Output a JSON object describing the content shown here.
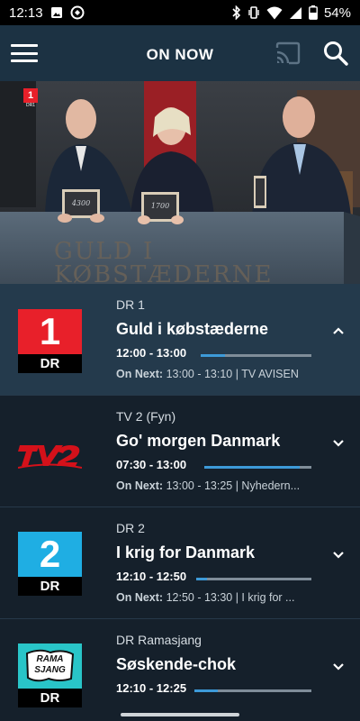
{
  "status_bar": {
    "time": "12:13",
    "battery": "54%"
  },
  "app_bar": {
    "title": "ON NOW"
  },
  "video": {
    "channel_badge": "1",
    "channel_badge_sub": "DR1",
    "set_text": "GULD I KØBSTÆDERNE",
    "slate_left": "4300",
    "slate_right": "1700"
  },
  "rows": [
    {
      "channel": "DR 1",
      "title": "Guld i købstæderne",
      "time": "12:00 - 13:00",
      "on_next_label": "On Next:",
      "on_next": " 13:00 - 13:10 | TV AVISEN",
      "progress": 0.22,
      "logo_digit": "1",
      "logo_text": "DR",
      "logo_color": "#e8202a",
      "expanded": true
    },
    {
      "channel": "TV 2 (Fyn)",
      "title": "Go' morgen Danmark",
      "time": "07:30 - 13:00",
      "on_next_label": "On Next:",
      "on_next": " 13:00 - 13:25 | Nyhedern...",
      "progress": 0.89,
      "logo_text": "TV2",
      "logo_color": "#d4111a",
      "expanded": false
    },
    {
      "channel": "DR 2",
      "title": "I krig for Danmark",
      "time": "12:10 - 12:50",
      "on_next_label": "On Next:",
      "on_next": " 12:50 - 13:30 | I krig for ...",
      "progress": 0.09,
      "logo_digit": "2",
      "logo_text": "DR",
      "logo_color": "#1faee3",
      "expanded": false
    },
    {
      "channel": "DR Ramasjang",
      "title": "Søskende-chok",
      "time": "12:10 - 12:25",
      "on_next_label": "",
      "on_next": "",
      "progress": 0.2,
      "logo_text": "DR",
      "logo_color": "#29c5c8",
      "logo_art": "RAMA SJANG",
      "expanded": false
    }
  ]
}
